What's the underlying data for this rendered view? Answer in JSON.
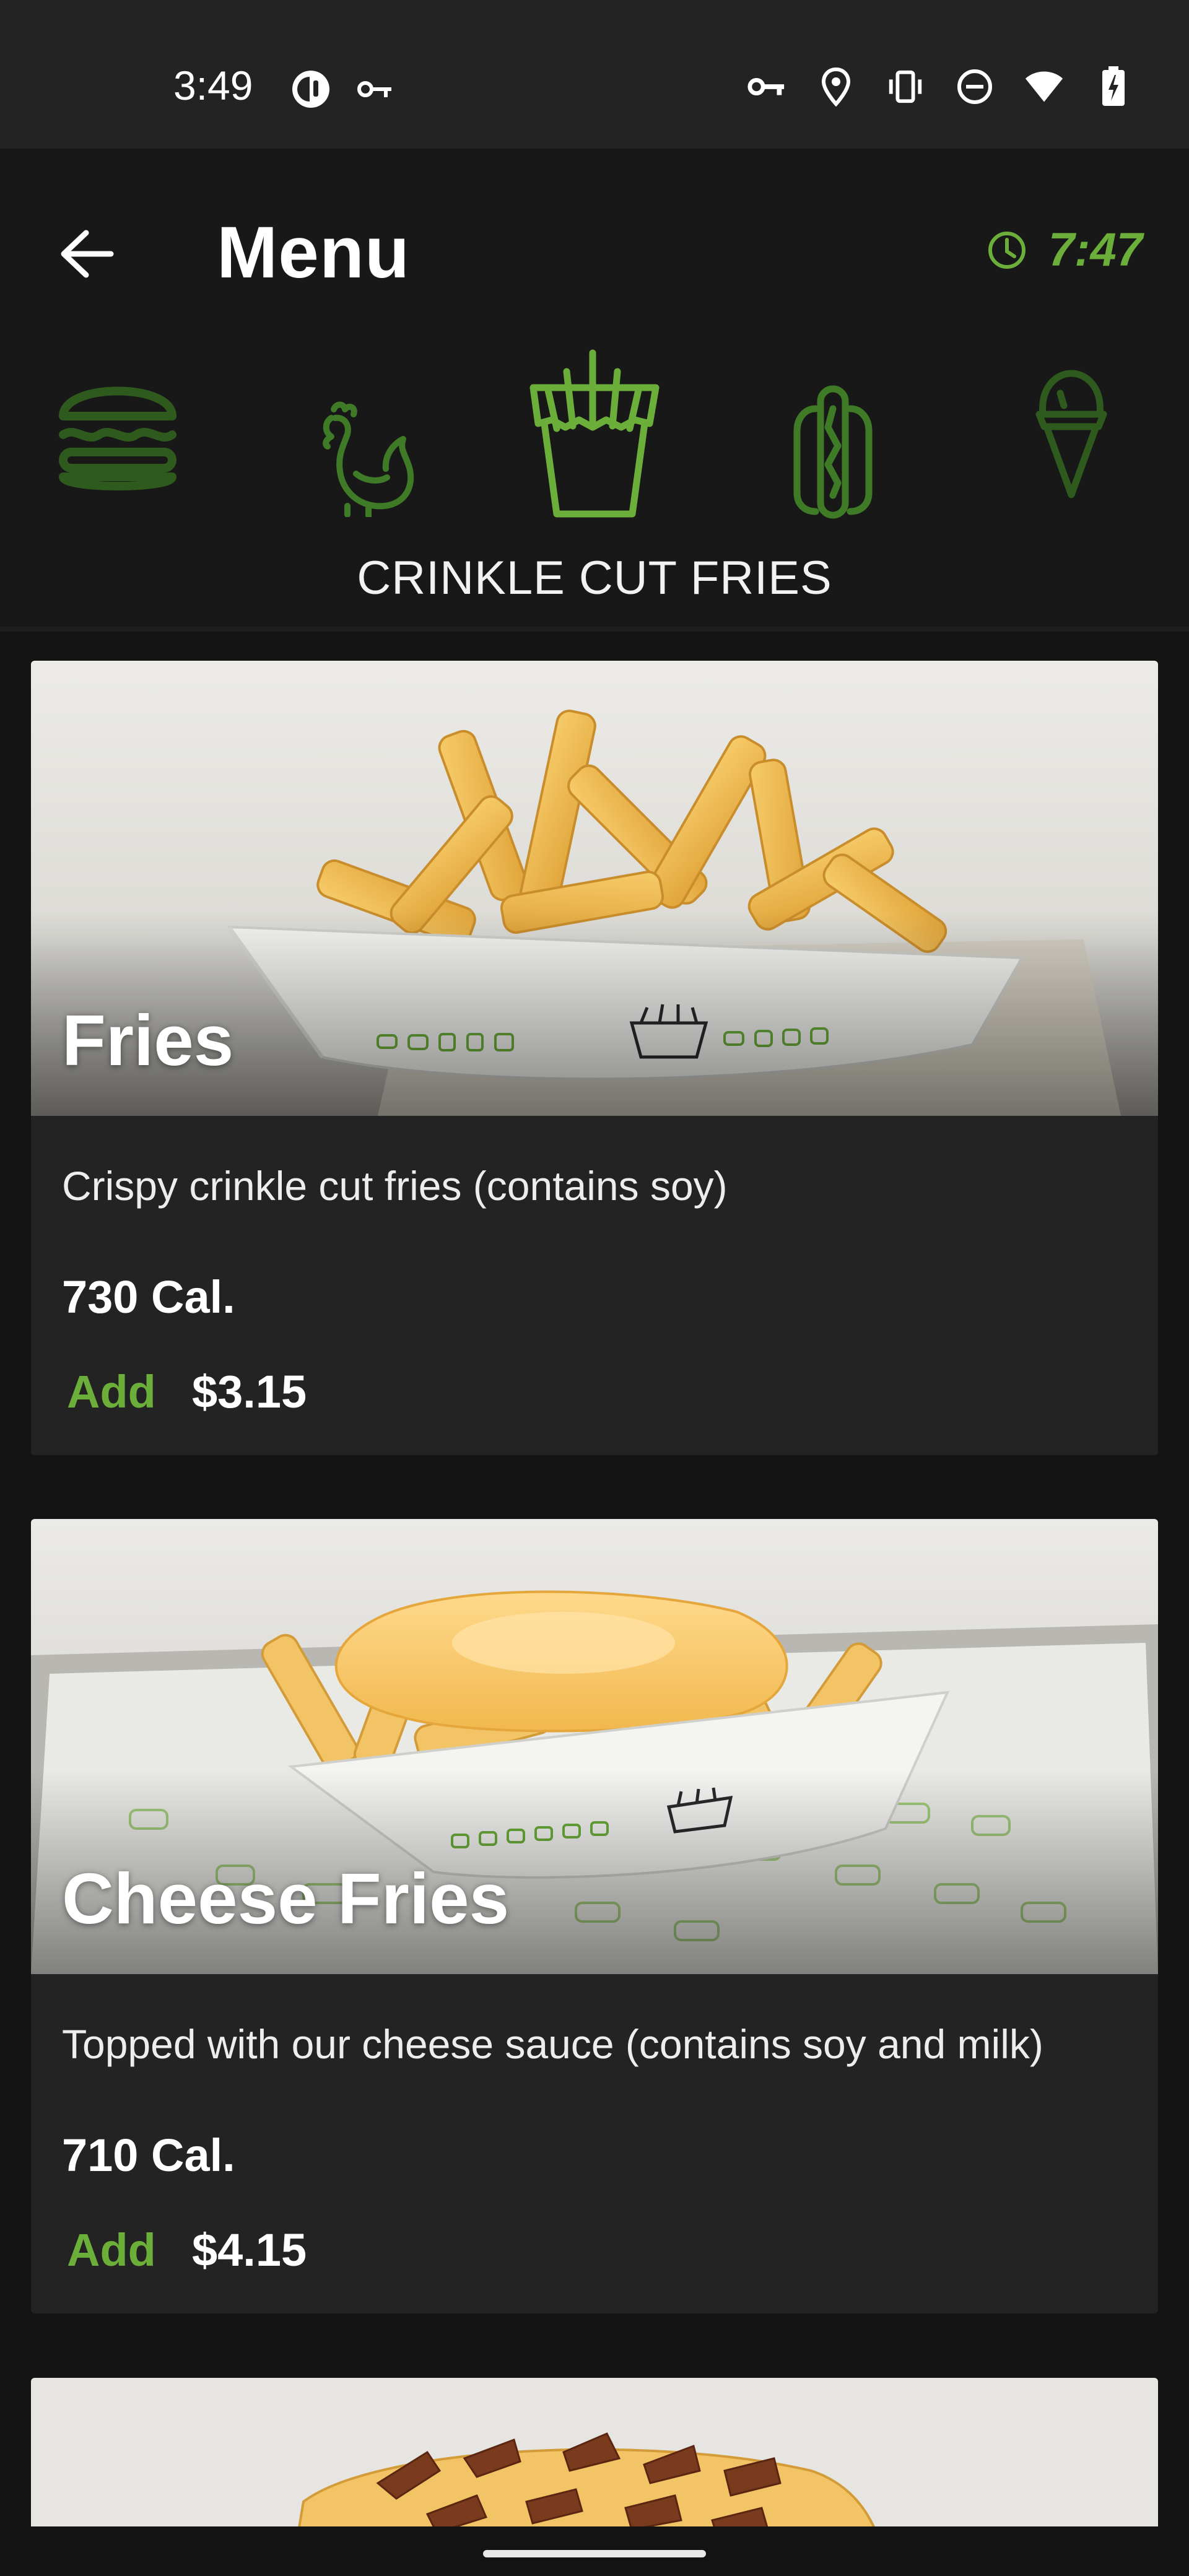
{
  "status_bar": {
    "time": "3:49",
    "left_icons": [
      "circle-app-icon",
      "key-icon"
    ],
    "right_icons": [
      "vpn-key-icon",
      "location-icon",
      "vibrate-icon",
      "do-not-disturb-icon",
      "wifi-icon",
      "battery-icon"
    ]
  },
  "header": {
    "title": "Menu",
    "timer": "7:47"
  },
  "categories": {
    "items": [
      {
        "name": "burger-icon",
        "selected": false
      },
      {
        "name": "chicken-icon",
        "selected": false
      },
      {
        "name": "fries-icon",
        "selected": true
      },
      {
        "name": "hot-dog-icon",
        "selected": false
      },
      {
        "name": "ice-cream-icon",
        "selected": false
      }
    ],
    "selected_label": "CRINKLE CUT FRIES"
  },
  "items": [
    {
      "name": "Fries",
      "description": "Crispy crinkle cut fries (contains soy)",
      "calories": "730 Cal.",
      "add_label": "Add",
      "price": "$3.15"
    },
    {
      "name": "Cheese Fries",
      "description": "Topped with our cheese sauce (contains soy and milk)",
      "calories": "710 Cal.",
      "add_label": "Add",
      "price": "$4.15"
    }
  ],
  "colors": {
    "accent": "#6cae3a",
    "accent_dim": "#2f5a1e",
    "background": "#131313",
    "card": "#232323"
  }
}
